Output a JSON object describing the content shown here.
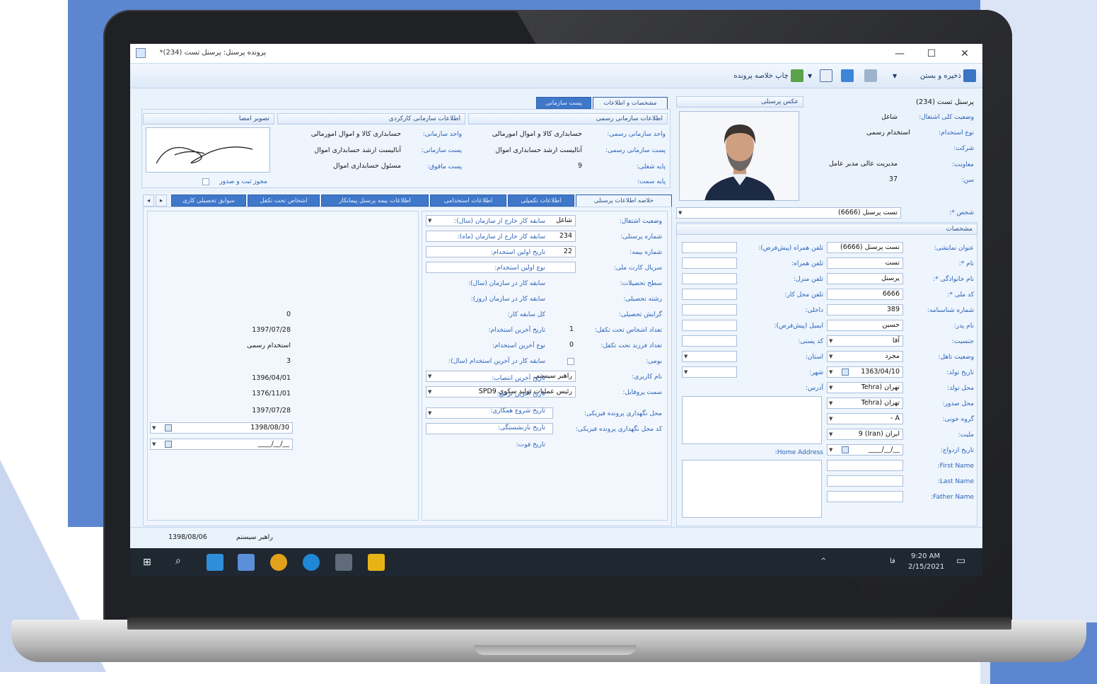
{
  "window": {
    "title": "پرونده پرسنل: پرسنل تست (234)*",
    "controls": {
      "minimize": "—",
      "maximize": "☐",
      "close": "✕"
    }
  },
  "toolbar": {
    "save_close": "ذخیره و بستن",
    "print_summary": "چاپ خلاصه پرونده"
  },
  "person": {
    "header_name": "پرسنل تست (234)",
    "overall_status_label": "وضعیت کلی اشتغال:",
    "overall_status": "شاغل",
    "employment_type_label": "نوع استخدام:",
    "employment_type": "استخدام رسمی",
    "company_label": "شرکت:",
    "deputy_label": "معاونت:",
    "deputy": "مدیریت عالی مدیر عامل",
    "age_label": "سن:",
    "age": "37",
    "photo_title": "عکس پرسنلی"
  },
  "org_tabs": {
    "tab1": "مشخصات و اطلاعات",
    "tab2": "پست سازمانی",
    "formal_title": "اطلاعات سازمانی رسمی",
    "functional_title": "اطلاعات سازمانی کارکردی",
    "signature_title": "تصویر امضا",
    "formal": {
      "unit_label": "واحد سازمانی رسمی:",
      "unit": "حسابداری کالا و اموال امورمالی",
      "post_label": "پست سازمانی رسمی:",
      "post": "آنالیست ارشد حسابداری اموال",
      "grade_label": "پایه شغلی:",
      "grade": "9",
      "job_grade_label": "پایه سمت:"
    },
    "functional": {
      "unit_label": "واحد سازمانی:",
      "unit": "حسابداری کالا و اموال امورمالی",
      "post_label": "پست سازمانی:",
      "post": "آنالیست ارشد حسابداری اموال",
      "target_label": "پست ماقوق:",
      "target": "مسئول حسابداری اموال"
    },
    "sig_check": "مجوز ثبت و صدور"
  },
  "person_select": {
    "label": "شخص *:",
    "value": "تست پرسنل (6666)"
  },
  "identity": {
    "title": "مشخصات",
    "display_label": "عنوان نمایشی:",
    "display": "تست پرسنل (6666)",
    "name_label": "نام *:",
    "name": "تست",
    "family_label": "نام خانوادگی *:",
    "family": "پرسنل",
    "national_label": "کد ملی *:",
    "national": "6666",
    "idno_label": "شماره شناسنامه:",
    "idno": "389",
    "father_label": "نام پدر:",
    "father": "حسین",
    "gender_label": "جنسیت:",
    "gender": "آقا",
    "marital_label": "وضعیت تاهل:",
    "marital": "مجرد",
    "birthdate_label": "تاریخ تولد:",
    "birthdate": "1363/04/10",
    "birthplace_label": "محل تولد:",
    "birthplace": "تهران (Tehra",
    "issueplace_label": "محل صدور:",
    "issueplace": "تهران (Tehra",
    "blood_label": "گروه خونی:",
    "blood": "A -",
    "nationality_label": "ملیت:",
    "nationality": "ایران (Iran) 9",
    "marriage_label": "تاریخ ازدواج:",
    "marriage": "__/__/____",
    "firstname_label": "First Name:",
    "lastname_label": "Last Name:",
    "fathername_label": "Father Name:",
    "mobile_default_label": "تلفن همراه (پیش‌فرض):",
    "mobile_label": "تلفن همراه:",
    "home_phone_label": "تلفن منزل:",
    "work_phone_label": "تلفن محل کار:",
    "internal_label": "داخلی:",
    "email_label": "ایمیل (پیش‌فرض):",
    "postal_label": "کد پستی:",
    "province_label": "استان:",
    "city_label": "شهر:",
    "address_label": "آدرس:",
    "home_address_label": "Home Address:"
  },
  "bottom_tabs": [
    "خلاصه اطلاعات پرسنلی",
    "اطلاعات تکمیلی",
    "اطلاعات استخدامی",
    "اطلاعات بیمه پرسنل پیمانکار",
    "اشخاص تحت تکفل",
    "سوابق تحصیلی کاری"
  ],
  "summary": {
    "emp_status_label": "وضعیت اشتغال:",
    "emp_status": "شاغل",
    "personnel_no_label": "شماره پرسنلی:",
    "personnel_no": "234",
    "insurance_no_label": "شماره بیمه:",
    "insurance_no": "22",
    "card_serial_label": "سریال کارت ملی:",
    "edu_level_label": "سطح تحصیلات:",
    "edu_field_label": "رشته تحصیلی:",
    "edu_trend_label": "گرایش تحصیلی:",
    "dependents_label": "تعداد اشخاص تحت تکفل:",
    "dependents": "1",
    "children_label": "تعداد فرزند تحت تکفل:",
    "children": "0",
    "veteran_label": "بومی:",
    "username_label": "نام کاربری:",
    "username": "راهبر سیستم",
    "profile_label": "سمت پروفایل:",
    "profile": "رئیس عملیات تولید سکوی SPD9",
    "archive_label": "محل نگهداری پرونده فیزیکی:",
    "archive_code_label": "کد محل نگهداری پرونده فیزیکی:",
    "ext_years_label": "سابقه کار خارج از سازمان (سال):",
    "ext_months_label": "سابقه کار خارج از سازمان (ماه):",
    "first_hire_date_label": "تاریخ اولین استخدام:",
    "first_hire_type_label": "نوع اولین استخدام:",
    "int_years_label": "سابقه کار در سازمان (سال):",
    "int_days_label": "سابقه کار در سازمان (روز):",
    "total_label": "کل سابقه کار:",
    "total": "0",
    "last_hire_date_label": "تاریخ آخرین استخدام:",
    "last_hire_date": "1397/07/28",
    "last_hire_type_label": "نوع آخرین استخدام:",
    "last_hire_type": "استخدام رسمی",
    "last_hire_years_label": "سابقه کار در آخرین استخدام (سال):",
    "last_hire_years": "3",
    "last_assign_label": "تاریخ آخرین انتصاب:",
    "last_assign": "1396/04/01",
    "last_promo_label": "تاریخ آخرین ترفیع:",
    "last_promo": "1376/11/01",
    "coop_start_label": "تاریخ شروع همکاری:",
    "coop_start": "1397/07/28",
    "retire_label": "تاریخ بازنشستگی:",
    "retire": "1398/08/30",
    "death_label": "تاریخ فوت:",
    "death": "__/__/____"
  },
  "status": {
    "user": "راهبر سیستم",
    "date": "1398/08/06"
  },
  "taskbar": {
    "time": "9:20 AM",
    "date": "2/15/2021",
    "lang": "فا"
  }
}
